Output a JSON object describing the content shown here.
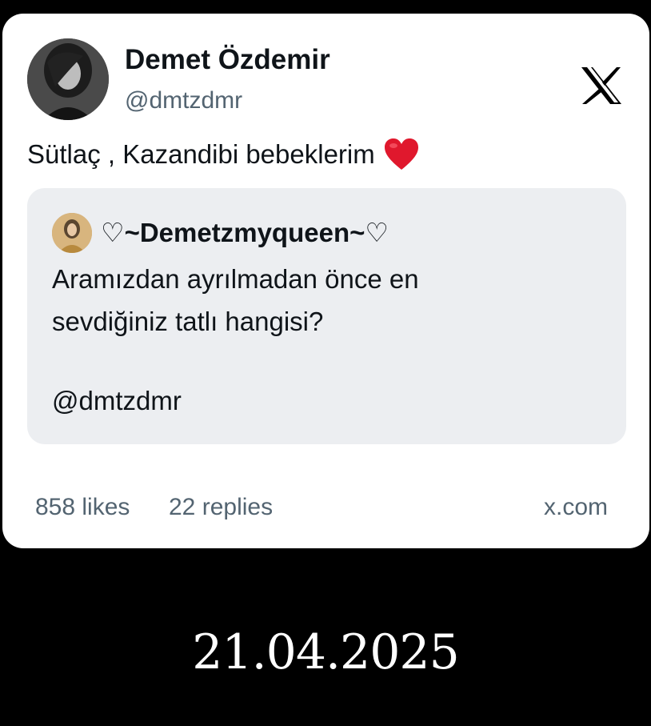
{
  "tweet": {
    "author_name": "Demet Özdemir",
    "author_handle": "@dmtzdmr",
    "text": "Sütlaç , Kazandibi bebeklerim",
    "emoji_icon": "red-heart-icon",
    "quoted": {
      "author_name": "♡~Demetzmyqueen~♡",
      "line1": "Aramızdan ayrılmadan önce en",
      "line2": "sevdiğiniz tatlı hangisi?",
      "mention": "@dmtzdmr"
    },
    "likes": "858 likes",
    "replies": "22 replies",
    "site": "x.com"
  },
  "date": "21.04.2025",
  "colors": {
    "background": "#000000",
    "card": "#ffffff",
    "quote_bg": "#eceef1",
    "secondary_text": "#536471",
    "heart": "#e0182d"
  }
}
